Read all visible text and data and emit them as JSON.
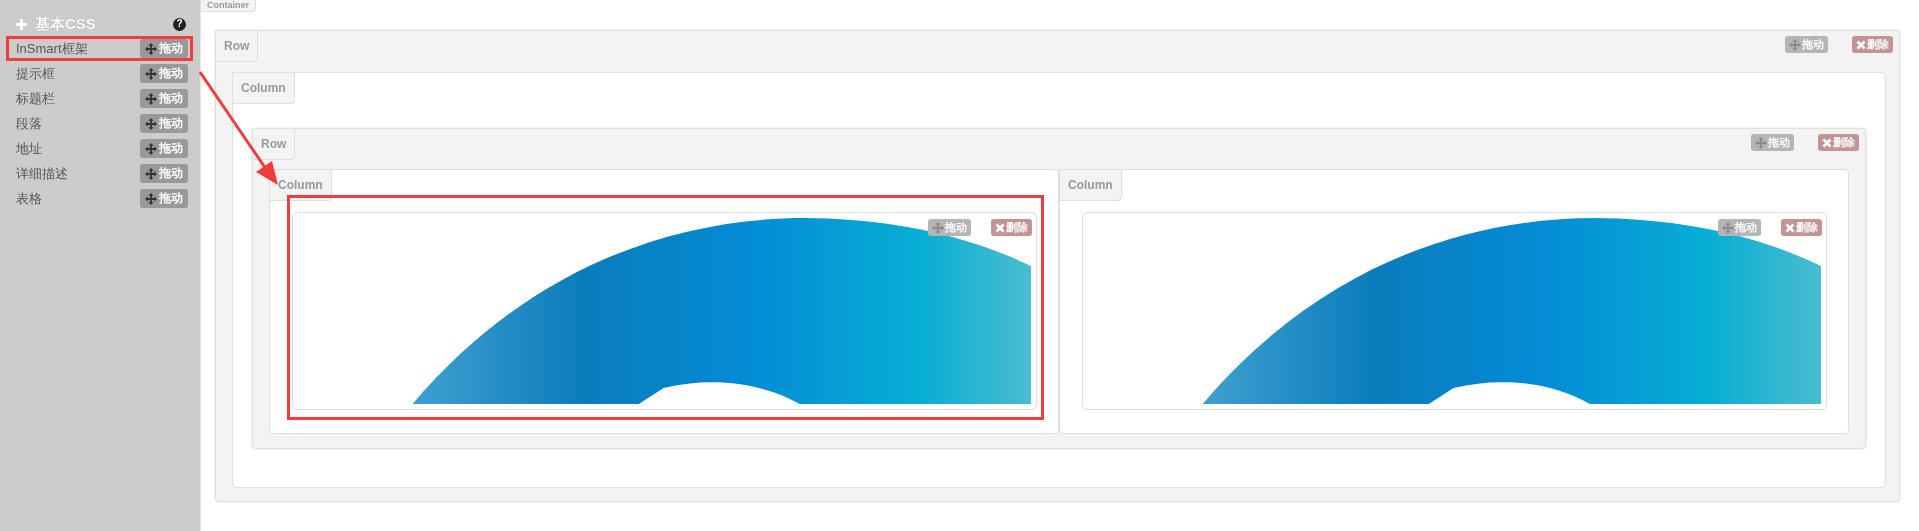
{
  "sidebar": {
    "title": "基本CSS",
    "help": "?",
    "items": [
      {
        "label": "InSmart框架",
        "drag": "拖动",
        "highlighted": true
      },
      {
        "label": "提示框",
        "drag": "拖动",
        "highlighted": false
      },
      {
        "label": "标题栏",
        "drag": "拖动",
        "highlighted": false
      },
      {
        "label": "段落",
        "drag": "拖动",
        "highlighted": false
      },
      {
        "label": "地址",
        "drag": "拖动",
        "highlighted": false
      },
      {
        "label": "详细描述",
        "drag": "拖动",
        "highlighted": false
      },
      {
        "label": "表格",
        "drag": "拖动",
        "highlighted": false
      }
    ]
  },
  "canvas": {
    "container_label": "Container",
    "row": {
      "label": "Row",
      "drag": "拖动",
      "remove": "删除",
      "column": {
        "label": "Column",
        "row": {
          "label": "Row",
          "drag": "拖动",
          "remove": "删除",
          "columns": [
            {
              "label": "Column",
              "component": {
                "drag": "拖动",
                "remove": "删除",
                "highlighted": true
              }
            },
            {
              "label": "Column",
              "component": {
                "drag": "拖动",
                "remove": "删除",
                "highlighted": false
              }
            }
          ]
        }
      }
    }
  },
  "annotation": {
    "arrow": true
  }
}
